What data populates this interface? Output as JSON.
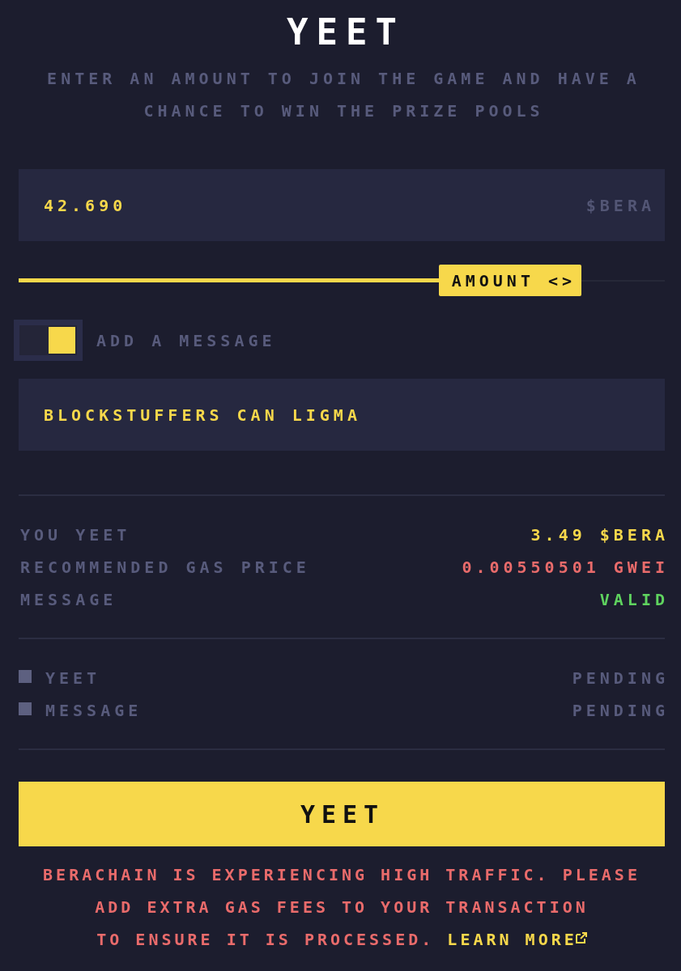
{
  "header": {
    "title": "YEET",
    "subtitle": "ENTER AN AMOUNT TO JOIN THE GAME AND HAVE A CHANCE TO WIN THE PRIZE POOLS"
  },
  "amount_field": {
    "value": "42.690",
    "unit": "$BERA"
  },
  "amount_slider": {
    "level": 0.65,
    "handle_label": "AMOUNT <>"
  },
  "message_toggle": {
    "label": "ADD A MESSAGE",
    "on": true
  },
  "message_field": {
    "value": "BLOCKSTUFFERS CAN LIGMA"
  },
  "summary": [
    {
      "label": "YOU YEET",
      "value": "3.49 $BERA",
      "color": "#f7d84b"
    },
    {
      "label": "RECOMMENDED GAS PRICE",
      "value": "0.00550501 GWEI",
      "color": "#e96b6b"
    },
    {
      "label": "MESSAGE",
      "value": "VALID",
      "color": "#5fd35f"
    }
  ],
  "steps": [
    {
      "label": "YEET",
      "status": "PENDING"
    },
    {
      "label": "MESSAGE",
      "status": "PENDING"
    }
  ],
  "submit_button": {
    "label": "YEET"
  },
  "notice": {
    "lines": [
      "BERACHAIN IS EXPERIENCING HIGH TRAFFIC. PLEASE ADD EXTRA GAS FEES TO YOUR TRANSACTION",
      "TO ENSURE IT IS PROCESSED."
    ],
    "link": "LEARN MORE"
  }
}
